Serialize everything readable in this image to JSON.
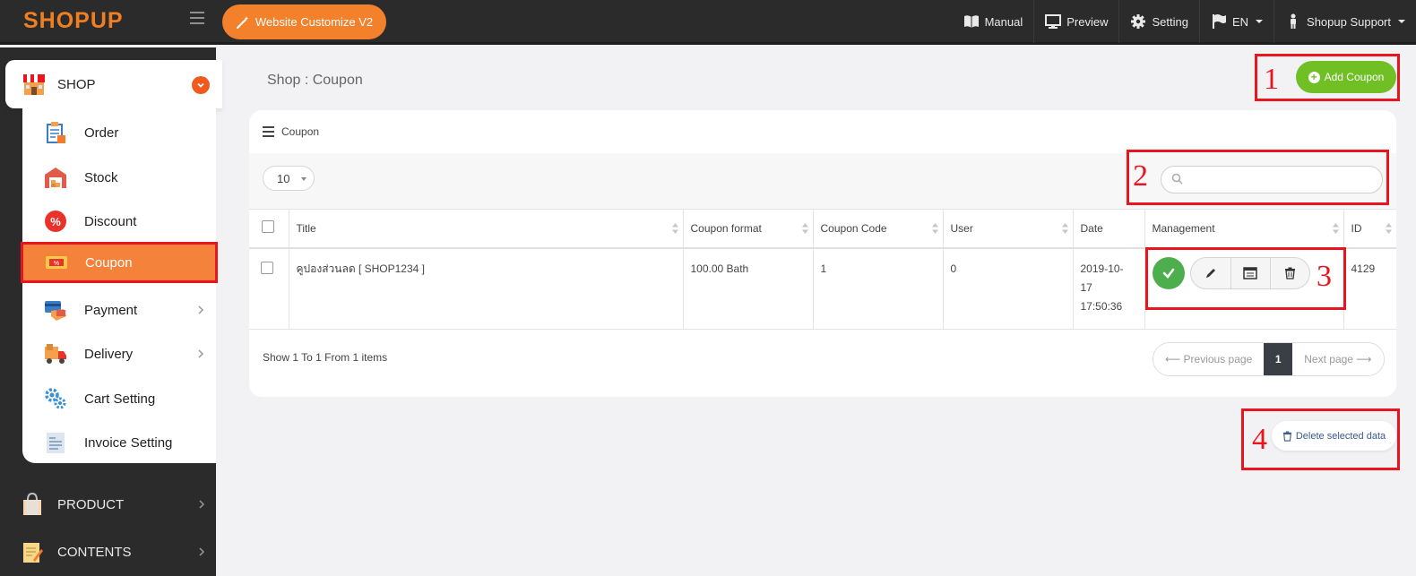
{
  "brand": {
    "logo_text_a": "SHOP",
    "logo_text_b": "UP",
    "accent": "#f3812c"
  },
  "header": {
    "customize_label": "Website Customize V2",
    "nav": [
      {
        "label": "Manual",
        "icon": "book-icon"
      },
      {
        "label": "Preview",
        "icon": "monitor-icon"
      },
      {
        "label": "Setting",
        "icon": "gear-icon"
      },
      {
        "label": "EN",
        "icon": "flag-icon"
      },
      {
        "label": "Shopup Support",
        "icon": "person-icon"
      }
    ]
  },
  "sidebar": {
    "shop_label": "SHOP",
    "sub_items": [
      {
        "label": "Order"
      },
      {
        "label": "Stock"
      },
      {
        "label": "Discount"
      },
      {
        "label": "Coupon",
        "active": true
      },
      {
        "label": "Payment"
      },
      {
        "label": "Delivery"
      },
      {
        "label": "Cart Setting"
      },
      {
        "label": "Invoice Setting"
      }
    ],
    "main_items": [
      {
        "label": "PRODUCT"
      },
      {
        "label": "CONTENTS"
      }
    ]
  },
  "page": {
    "title": "Shop : Coupon",
    "add_button": "Add Coupon",
    "card_title": "Coupon",
    "page_size": "10",
    "search_placeholder": "",
    "columns": [
      "Title",
      "Coupon format",
      "Coupon Code",
      "User",
      "Date",
      "Management",
      "ID"
    ],
    "rows": [
      {
        "title": "คูปองส่วนลด [ SHOP1234 ]",
        "format": "100.00 Bath",
        "code": "1",
        "user": "0",
        "date_a": "2019-10-",
        "date_b": "17",
        "date_c": "17:50:36",
        "id": "4129"
      }
    ],
    "footer_info": "Show 1 To 1 From 1 items",
    "pager": {
      "prev": "⟵ Previous page",
      "current": "1",
      "next": "Next page ⟶"
    },
    "delete_label": "Delete selected data"
  },
  "annotations": [
    "1",
    "2",
    "3",
    "4"
  ]
}
